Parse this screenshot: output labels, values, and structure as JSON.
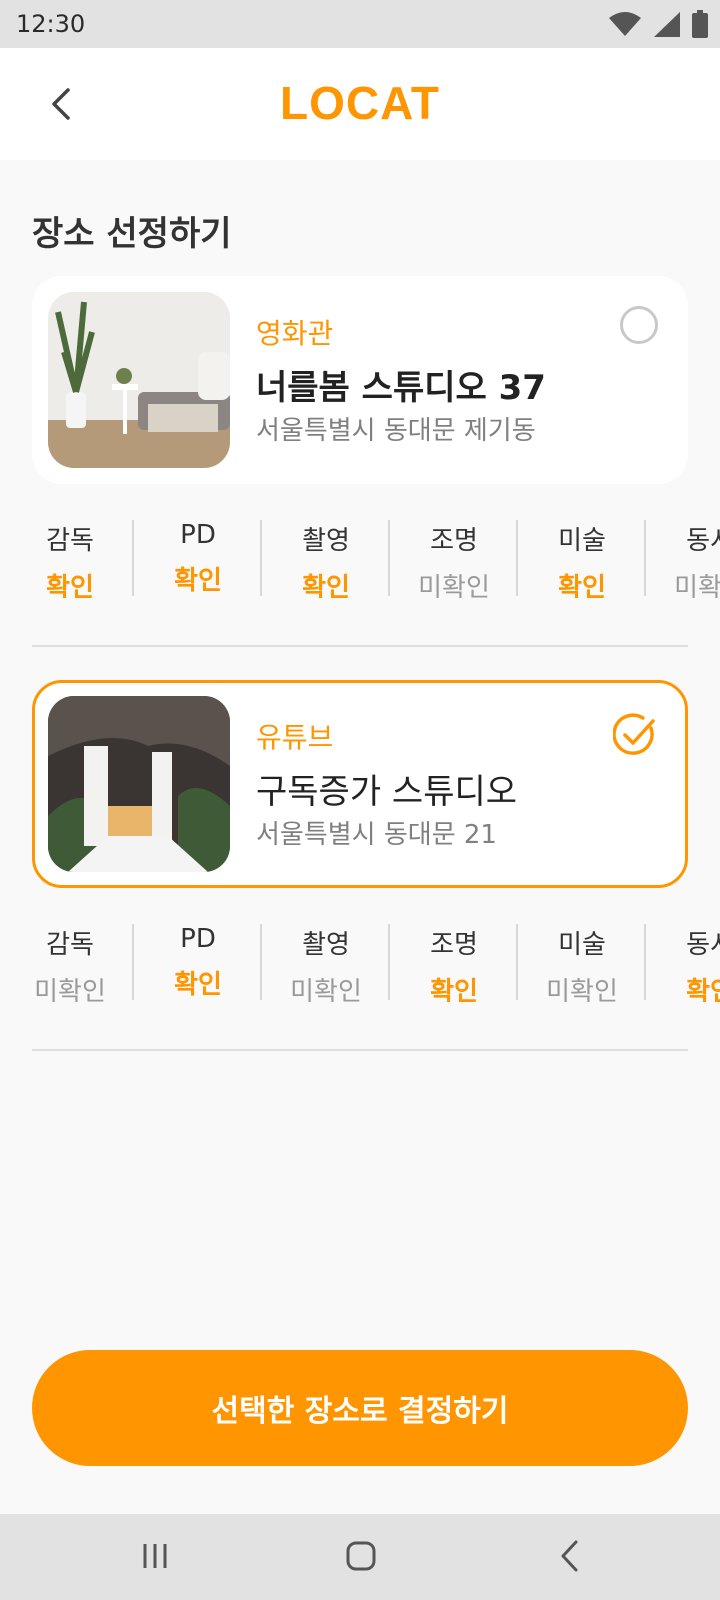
{
  "status_bar": {
    "time": "12:30",
    "icons": [
      "wifi-icon",
      "signal-icon",
      "battery-icon"
    ]
  },
  "app_bar": {
    "title": "LOCAT",
    "back_icon": "chevron-left-icon"
  },
  "section_title": "장소 선정하기",
  "locations": [
    {
      "category": "영화관",
      "name": "너를봄 스튜디오 37",
      "address": "서울특별시 동대문 제기동",
      "selected": false,
      "roles": [
        {
          "name": "감독",
          "status": "확인",
          "confirmed": true
        },
        {
          "name": "PD",
          "status": "확인",
          "confirmed": true
        },
        {
          "name": "촬영",
          "status": "확인",
          "confirmed": true
        },
        {
          "name": "조명",
          "status": "미확인",
          "confirmed": false
        },
        {
          "name": "미술",
          "status": "확인",
          "confirmed": true
        },
        {
          "name": "동시",
          "status": "미확인",
          "confirmed": false
        }
      ]
    },
    {
      "category": "유튜브",
      "name": "구독증가 스튜디오",
      "address": "서울특별시 동대문  21",
      "selected": true,
      "roles": [
        {
          "name": "감독",
          "status": "미확인",
          "confirmed": false
        },
        {
          "name": "PD",
          "status": "확인",
          "confirmed": true
        },
        {
          "name": "촬영",
          "status": "미확인",
          "confirmed": false
        },
        {
          "name": "조명",
          "status": "확인",
          "confirmed": true
        },
        {
          "name": "미술",
          "status": "미확인",
          "confirmed": false
        },
        {
          "name": "동시",
          "status": "확인",
          "confirmed": true
        }
      ]
    }
  ],
  "cta_label": "선택한 장소로 결정하기",
  "nav_bar": {
    "icons": [
      "recent-apps-icon",
      "home-icon",
      "back-icon"
    ]
  },
  "colors": {
    "accent": "#ff9500",
    "unconfirmed": "#9a9a9a"
  }
}
